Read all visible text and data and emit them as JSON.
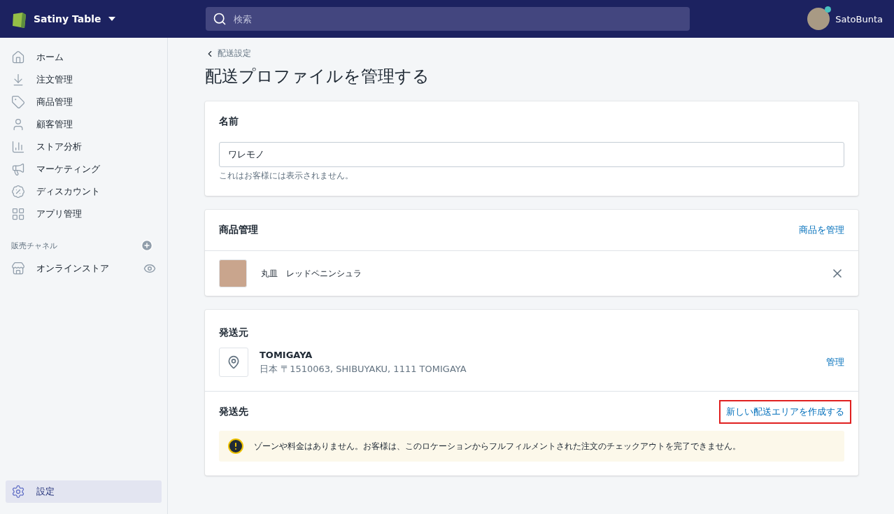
{
  "topbar": {
    "store_name": "Satiny Table",
    "search": {
      "placeholder": "検索"
    },
    "user": {
      "name": "SatoBunta"
    }
  },
  "sidebar": {
    "items": [
      {
        "label": "ホーム",
        "selected": false
      },
      {
        "label": "注文管理",
        "selected": false
      },
      {
        "label": "商品管理",
        "selected": false
      },
      {
        "label": "顧客管理",
        "selected": false
      },
      {
        "label": "ストア分析",
        "selected": false
      },
      {
        "label": "マーケティング",
        "selected": false
      },
      {
        "label": "ディスカウント",
        "selected": false
      },
      {
        "label": "アプリ管理",
        "selected": false
      }
    ],
    "channels_heading": "販売チャネル",
    "channels": [
      {
        "label": "オンラインストア",
        "selected": false
      }
    ],
    "settings": {
      "label": "設定",
      "selected": true
    }
  },
  "breadcrumb": "配送設定",
  "page_title": "配送プロファイルを管理する",
  "name_card": {
    "title": "名前",
    "value": "ワレモノ",
    "help": "これはお客様には表示されません。"
  },
  "products_card": {
    "title": "商品管理",
    "action": "商品を管理",
    "products": [
      {
        "name": "丸皿　レッドペニンシュラ"
      }
    ]
  },
  "shipping_card": {
    "origin_title": "発送元",
    "location": {
      "name": "TOMIGAYA",
      "address": "日本 〒1510063, SHIBUYAKU, 1111 TOMIGAYA"
    },
    "manage": "管理",
    "destination_title": "発送先",
    "create_zone": {
      "label": "新しい配送エリアを作成する",
      "highlighted": true
    },
    "warning": "ゾーンや料金はありません。お客様は、このロケーションからフルフィルメントされた注文のチェックアウトを完了できません。"
  }
}
